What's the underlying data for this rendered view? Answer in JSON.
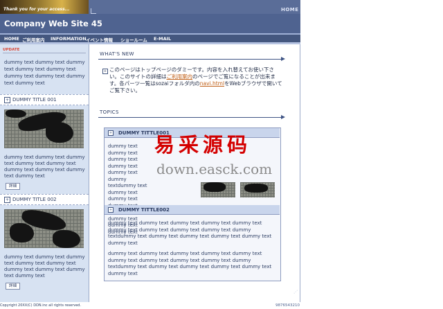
{
  "header": {
    "tagline": "Thank you for your access...",
    "home_link": "HOME",
    "site_title": "Company Web Site 45"
  },
  "nav": {
    "items": [
      "HOME",
      "ご利用案内",
      "INFORMATION",
      "イベント情報",
      "ショールーム",
      "E-MAIL"
    ]
  },
  "sidebar": {
    "update_label": "UPDATE",
    "update_text": "dummy text dummy text dummy text dummy text dummy text dummy text dummy text dummy text dummy text",
    "blocks": [
      {
        "title": "DUMMY TITLE 001",
        "text": "dummy text dummy text dummy text dummy text dummy text dummy text dummy text dummy text dummy text",
        "button": "詳細"
      },
      {
        "title": "DUMMY TITLE 002",
        "text": "dummy text dummy text dummy text dummy text dummy text dummy text dummy text dummy text dummy text",
        "button": "詳細"
      }
    ]
  },
  "whats_new": {
    "heading": "WHAT'S NEW",
    "text_1": "このページはトップページのダミーです。内容を入れ替えてお使い下さい。このサイトの詳細は",
    "link_1": "ご利用案内",
    "text_2": "のページでご覧になることが出来ます。各パーツ一覧はsozaiフォルダ内の",
    "link_2": "navi.html",
    "text_3": "をWebブラウザで開いてご覧下さい。"
  },
  "topics": {
    "heading": "TOPICS",
    "items": [
      {
        "title": "DUMMY TITTLE001",
        "text": "dummy text dummy text dummy text dummy text dummy text dummy textdummy text dummy text dummy text dummy text dummy text dummy text dummy text dummy text"
      },
      {
        "title": "DUMMY TITTLE002",
        "text": "dummy text dummy text dummy text dummy text dummy text dummy text dummy text dummy text dummy text dummy textdummy text dummy text dummy text dummy text dummy text dummy text",
        "text_2": "dummy text dummy text dummy text dummy text dummy text dummy text dummy text dummy text dummy text dummy textdummy text dummy text dummy text dummy text dummy text dummy text"
      }
    ]
  },
  "footer": {
    "copyright": "Copyright 20XX(C) DDN.inc all rights reserved.",
    "phone": "9876543210"
  },
  "watermark": {
    "chinese": "易采源码",
    "domain": "down.easck.com"
  }
}
